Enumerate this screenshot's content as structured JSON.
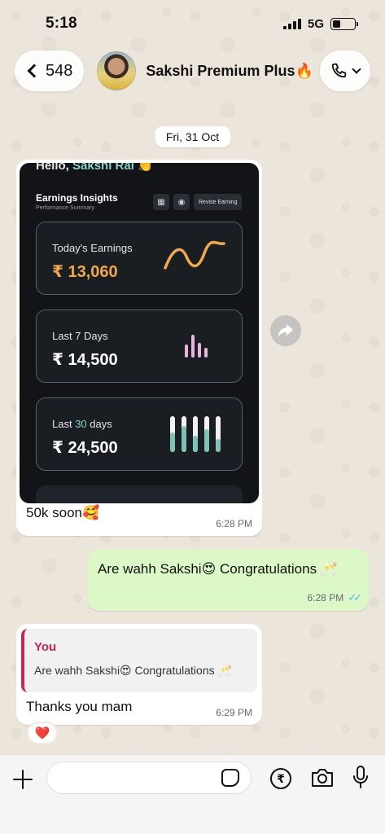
{
  "status_bar": {
    "time": "5:18",
    "network": "5G",
    "battery_level": 0.35
  },
  "header": {
    "back_count": "548",
    "contact_name": "Sakshi Premium Plus🔥"
  },
  "date_chip": "Fri, 31 Oct",
  "messages": {
    "incoming_image": {
      "dashboard": {
        "hello": "Hello, ",
        "hello_name": "Sakshi Rai 👏",
        "title": "Earnings Insights",
        "subtitle": "Performance Summary",
        "revise_button": "Revise Earning",
        "cards": [
          {
            "label": "Today's Earnings",
            "value": "₹ 13,060"
          },
          {
            "label_prefix": "Last 7 Days",
            "value": "₹ 14,500"
          },
          {
            "label_prefix": "Last ",
            "label_accent": "30",
            "label_suffix": " days",
            "value": "₹ 24,500"
          }
        ]
      },
      "caption": "50k soon🥰",
      "time": "6:28 PM"
    },
    "outgoing": {
      "text": "Are wahh Sakshi😍 Congratulations 🥂",
      "time": "6:28 PM"
    },
    "reply": {
      "quote_author": "You",
      "quote_text": "Are wahh Sakshi😍 Congratulations 🥂",
      "text": "Thanks you mam",
      "time": "6:29 PM",
      "reaction": "❤️"
    }
  },
  "composer": {
    "placeholder": ""
  },
  "colors": {
    "outgoing_bubble": "#dcf8c6",
    "quote_accent": "#c6245a",
    "read_ticks": "#4fb6ec",
    "dash_teal": "#7fd3c9",
    "dash_orange": "#f0a94a"
  }
}
